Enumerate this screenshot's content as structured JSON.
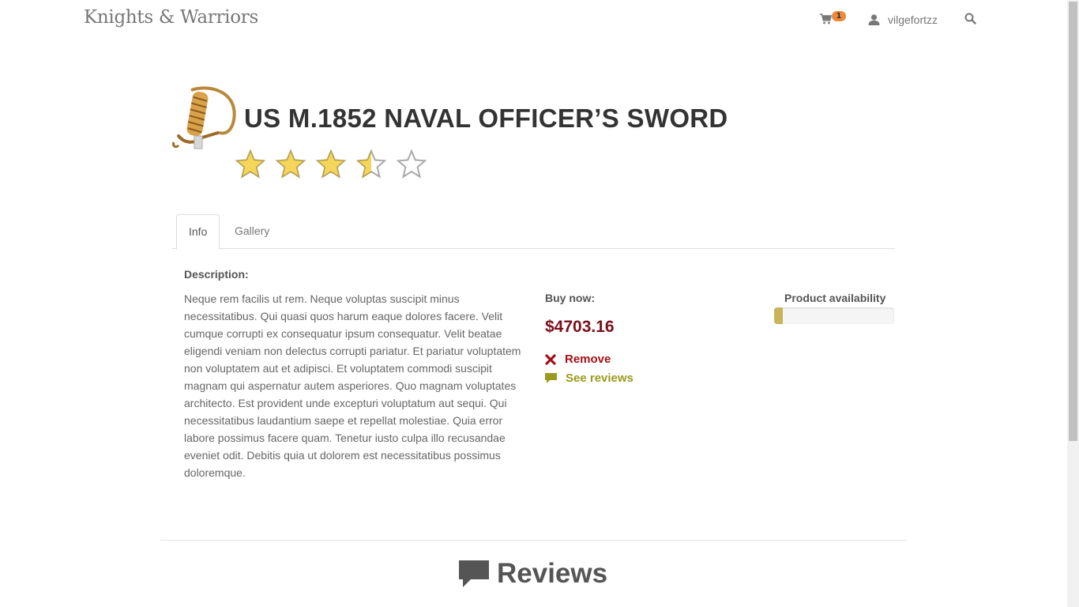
{
  "navbar": {
    "brand": "Knights & Warriors",
    "cart_icon": "shopping-cart-icon",
    "cart_count": "1",
    "user_icon": "user-icon",
    "username": "vilgefortzz",
    "search_icon": "search-icon"
  },
  "product": {
    "image_icon": "sword-image",
    "title": "US M.1852 NAVAL OFFICER’S SWORD",
    "rating": 3.5,
    "rating_max": 5,
    "star_color": "#f5d65b"
  },
  "tabs": [
    {
      "label": "Info",
      "active": true
    },
    {
      "label": "Gallery",
      "active": false
    }
  ],
  "info": {
    "description_label": "Description:",
    "description": "Neque rem facilis ut rem. Neque voluptas suscipit minus necessitatibus. Qui quasi quos harum eaque dolores facere. Velit cumque corrupti ex consequatur ipsum consequatur. Velit beatae eligendi veniam non delectus corrupti pariatur. Et pariatur voluptatem non voluptatem aut et adipisci. Et voluptatem commodi suscipit magnam qui aspernatur autem asperiores. Quo magnam voluptates architecto. Est provident unde excepturi voluptatum aut sequi. Qui necessitatibus laudantium saepe et repellat molestiae. Quia error labore possimus facere quam. Tenetur iusto culpa illo recusandae eveniet odit. Debitis quia ut dolorem est necessitatibus possimus doloremque.",
    "buy_label": "Buy now:",
    "price": "$4703.16",
    "price_color": "#7a0f1c",
    "remove_label": "Remove",
    "remove_icon": "close-icon",
    "remove_color": "#a50f17",
    "see_reviews_label": "See reviews",
    "see_reviews_icon": "comment-icon",
    "see_reviews_color": "#9a9a1e",
    "availability_label": "Product availability",
    "availability_fraction": 0.07,
    "availability_color": "#c8b35a"
  },
  "reviews": {
    "heading": "Reviews",
    "heading_icon": "comment-icon"
  }
}
